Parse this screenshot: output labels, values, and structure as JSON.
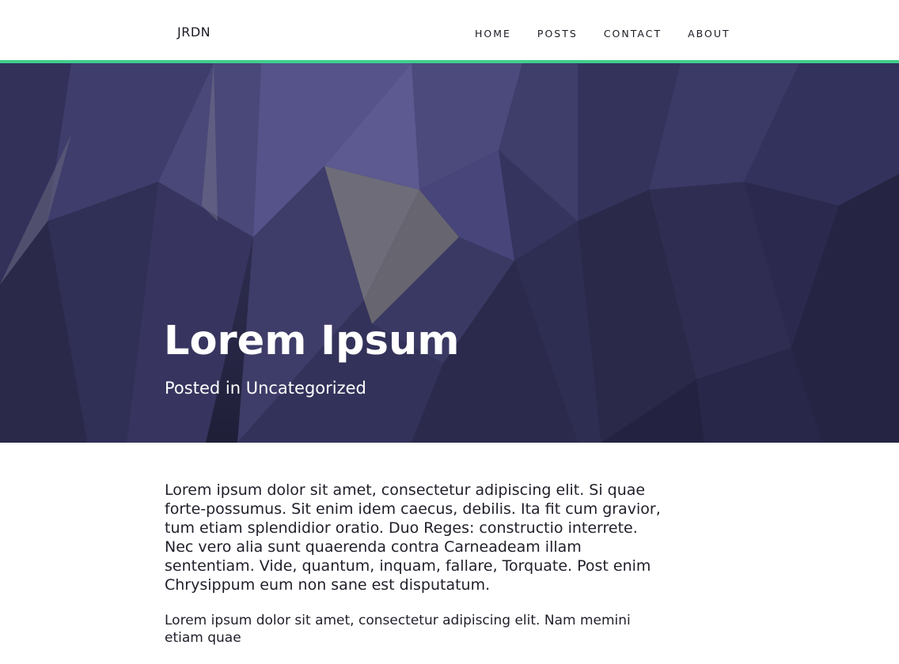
{
  "site": {
    "logo": "JRDN"
  },
  "nav": {
    "items": [
      "HOME",
      "POSTS",
      "CONTACT",
      "ABOUT"
    ]
  },
  "colors": {
    "accent": "#3ecf8e",
    "hero_bg": "#2c2b4d"
  },
  "hero": {
    "title": "Lorem Ipsum",
    "meta_prefix": "Posted in",
    "category": "Uncategorized"
  },
  "article": {
    "paragraphs": [
      "Lorem ipsum dolor sit amet, consectetur adipiscing elit. Si quae forte-possumus. Sit enim idem caecus, debilis. Ita fit cum gravior, tum etiam splendidior oratio. Duo Reges: constructio interrete. Nec vero alia sunt quaerenda contra Carneadeam illam sententiam. Vide, quantum, inquam, fallare, Torquate. Post enim Chrysippum eum non sane est disputatum.",
      "Lorem ipsum dolor sit amet, consectetur adipiscing elit. Nam memini etiam quae"
    ]
  }
}
